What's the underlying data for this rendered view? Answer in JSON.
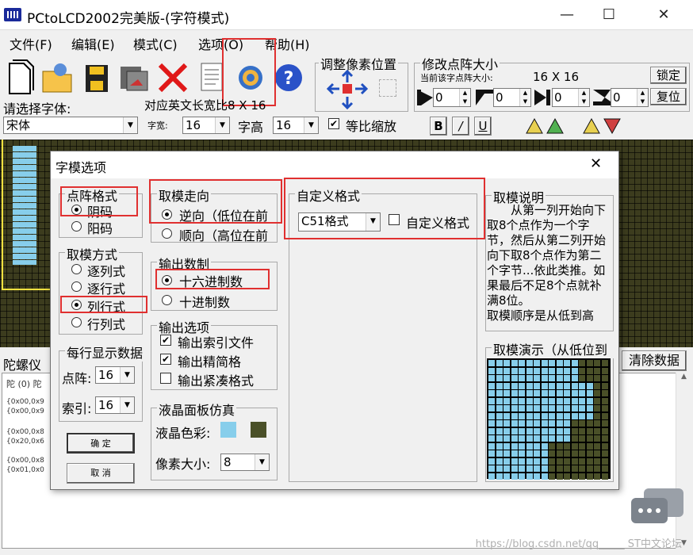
{
  "window": {
    "title": "PCtoLCD2002完美版-(字符模式)",
    "minimize": "—",
    "maximize": "☐",
    "close": "✕"
  },
  "menu": [
    "文件(F)",
    "编辑(E)",
    "模式(C)",
    "选项(O)",
    "帮助(H)"
  ],
  "toolbar": {
    "adjust_title": "调整像素位置",
    "resize_title": "修改点阵大小",
    "current_size_label": "当前该字点阵大小:",
    "current_size_value": "16  X  16",
    "lock_button": "锁定",
    "restore_button": "复位",
    "spin_values": [
      "0",
      "0",
      "0",
      "0"
    ],
    "font_prompt": "请选择字体:",
    "ratio_text": "对应英文长宽比8 X 16",
    "font_value": "宋体",
    "width_label": "字宽:",
    "width_value": "16",
    "height_label": "字高",
    "height_value": "16",
    "proportional_label": "等比缩放",
    "proportional_checked": true,
    "bold": "B",
    "italic": "/",
    "underline": "U"
  },
  "bottom": {
    "label": "陀螺仪",
    "clear_button": "清除数据",
    "code_lines": [
      "陀 (0) 陀",
      "{0x00,0x9",
      "{0x00,0x9",
      "{0x00,0x8",
      "{0x20,0x6",
      "{0x00,0x8",
      "{0x01,0x0"
    ]
  },
  "dialog": {
    "title": "字模选项",
    "close": "✕",
    "dot_format": {
      "title": "点阵格式",
      "options": [
        "阴码",
        "阳码"
      ],
      "selected": 0
    },
    "scan_mode": {
      "title": "取模方式",
      "options": [
        "逐列式",
        "逐行式",
        "列行式",
        "行列式"
      ],
      "selected": 2
    },
    "per_row": {
      "title": "每行显示数据",
      "dot_label": "点阵:",
      "dot_value": "16",
      "index_label": "索引:",
      "index_value": "16"
    },
    "ok_button": "确  定",
    "cancel_button": "取  消",
    "direction": {
      "title": "取模走向",
      "options": [
        "逆向（低位在前",
        "顺向（高位在前"
      ],
      "selected": 0
    },
    "number_base": {
      "title": "输出数制",
      "options": [
        "十六进制数",
        "十进制数"
      ],
      "selected": 0
    },
    "output_options": {
      "title": "输出选项",
      "items": [
        {
          "label": "输出索引文件",
          "checked": true
        },
        {
          "label": "输出精简格",
          "checked": true
        },
        {
          "label": "输出紧凑格式",
          "checked": false
        }
      ]
    },
    "lcd_sim": {
      "title": "液晶面板仿真",
      "color_label": "液晶色彩:",
      "pixel_label": "像素大小:",
      "pixel_value": "8",
      "color_on": "#87ceeb",
      "color_off": "#4a5028"
    },
    "custom": {
      "title": "自定义格式",
      "format_value": "C51格式",
      "custom_label": "自定义格式",
      "custom_checked": false
    },
    "explain": {
      "title": "取模说明",
      "text": "从第一列开始向下取8个点作为一个字节，然后从第二列开始向下取8个点作为第二个字节...依此类推。如果最后不足8个点就补满8位。\n取模顺序是从低到高"
    },
    "demo": {
      "title": "取模演示（从低位到"
    }
  },
  "watermark": "https://blog.csdn.net/qq_____ ST中文论坛"
}
